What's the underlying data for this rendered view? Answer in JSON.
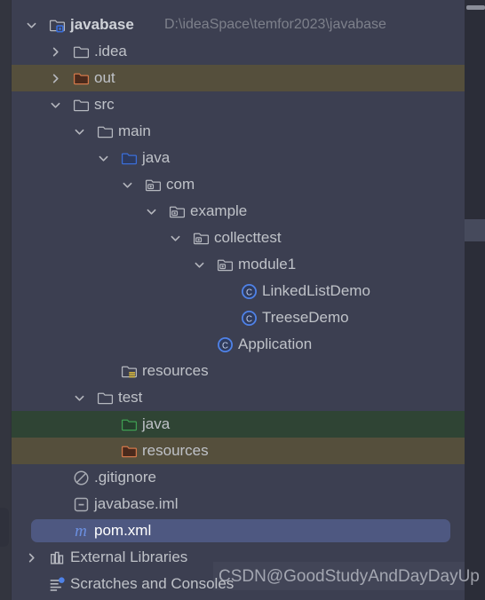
{
  "project": {
    "name": "javabase",
    "path": "D:\\ideaSpace\\temfor2023\\javabase"
  },
  "watermark": "CSDN@GoodStudyAndDayDayUp",
  "colors": {
    "panel_bg": "#3c3f51",
    "excluded_row": "#554f3c",
    "test_source_row": "#2f4434",
    "selection": "#4e5881",
    "source_folder_blue": "#3b6ed8",
    "test_folder_green": "#3f9e52",
    "excluded_folder_orange": "#d2784a",
    "class_icon_blue": "#4f82e8",
    "maven_icon_blue": "#6b8fe0",
    "text": "#bfc2c8",
    "path_text": "#7d808b"
  },
  "tree": {
    "rows": [
      {
        "label": "javabase",
        "path": "D:\\ideaSpace\\temfor2023\\javabase",
        "depth": 0,
        "arrow": "expanded",
        "icon": "project-folder-icon",
        "bold": true
      },
      {
        "label": ".idea",
        "depth": 1,
        "arrow": "collapsed",
        "icon": "folder-icon"
      },
      {
        "label": "out",
        "depth": 1,
        "arrow": "collapsed",
        "icon": "folder-excluded-icon",
        "row_state": "excluded"
      },
      {
        "label": "src",
        "depth": 1,
        "arrow": "expanded",
        "icon": "folder-icon"
      },
      {
        "label": "main",
        "depth": 2,
        "arrow": "expanded",
        "icon": "folder-icon"
      },
      {
        "label": "java",
        "depth": 3,
        "arrow": "expanded",
        "icon": "folder-sources-icon"
      },
      {
        "label": "com",
        "depth": 4,
        "arrow": "expanded",
        "icon": "package-icon"
      },
      {
        "label": "example",
        "depth": 5,
        "arrow": "expanded",
        "icon": "package-icon"
      },
      {
        "label": "collecttest",
        "depth": 6,
        "arrow": "expanded",
        "icon": "package-icon"
      },
      {
        "label": "module1",
        "depth": 7,
        "arrow": "expanded",
        "icon": "package-icon"
      },
      {
        "label": "LinkedListDemo",
        "depth": 8,
        "arrow": "none",
        "icon": "java-class-icon"
      },
      {
        "label": "TreeseDemo",
        "depth": 8,
        "arrow": "none",
        "icon": "java-class-icon"
      },
      {
        "label": "Application",
        "depth": 7,
        "arrow": "none",
        "icon": "java-class-icon"
      },
      {
        "label": "resources",
        "depth": 3,
        "arrow": "none",
        "icon": "folder-resources-icon"
      },
      {
        "label": "test",
        "depth": 2,
        "arrow": "expanded",
        "icon": "folder-icon"
      },
      {
        "label": "java",
        "depth": 3,
        "arrow": "none",
        "icon": "folder-test-sources-icon",
        "row_state": "testsrc"
      },
      {
        "label": "resources",
        "depth": 3,
        "arrow": "none",
        "icon": "folder-test-resources-icon",
        "row_state": "testres"
      },
      {
        "label": ".gitignore",
        "depth": 1,
        "arrow": "none",
        "icon": "gitignore-icon"
      },
      {
        "label": "javabase.iml",
        "depth": 1,
        "arrow": "none",
        "icon": "iml-file-icon"
      },
      {
        "label": "pom.xml",
        "depth": 1,
        "arrow": "none",
        "icon": "maven-file-icon",
        "row_state": "selected"
      },
      {
        "label": "External Libraries",
        "depth": 0,
        "arrow": "collapsed",
        "icon": "libraries-icon"
      },
      {
        "label": "Scratches and Consoles",
        "depth": 0,
        "arrow": "none",
        "icon": "scratches-icon"
      }
    ]
  }
}
